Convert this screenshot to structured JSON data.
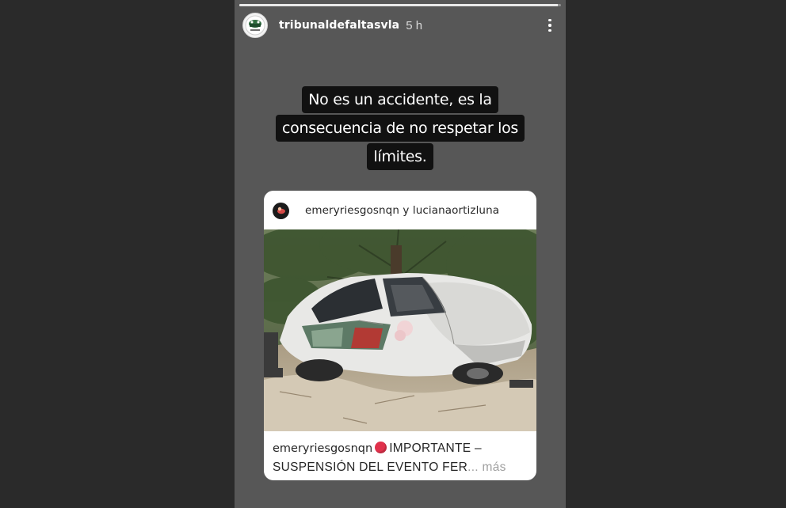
{
  "story": {
    "progress": 0.99,
    "username": "tribunaldefaltasvla",
    "time": "5 h",
    "menu_icon": "more-vertical-icon",
    "avatar_icon": "profile-logo-icon",
    "caption_lines": [
      "No es un accidente, es la",
      "consecuencia de no respetar los",
      "límites."
    ]
  },
  "shared_post": {
    "authors": "emeryriesgosnqn y lucianaortizluna",
    "avatar_icon": "profile-avatar-icon",
    "image_alt": "photo-crashed-white-car",
    "caption": {
      "handle": "emeryriesgosnqn",
      "emoji_icon": "red-circle-icon",
      "text_line1": "IMPORTANTE –",
      "text_line2": "SUSPENSIÓN DEL EVENTO FER",
      "ellipsis": "...",
      "more": "más"
    }
  },
  "colors": {
    "page_background": "#2a2a2a",
    "story_background": "#575757",
    "caption_highlight": "#111111",
    "emoji_red": "#e0314b"
  }
}
